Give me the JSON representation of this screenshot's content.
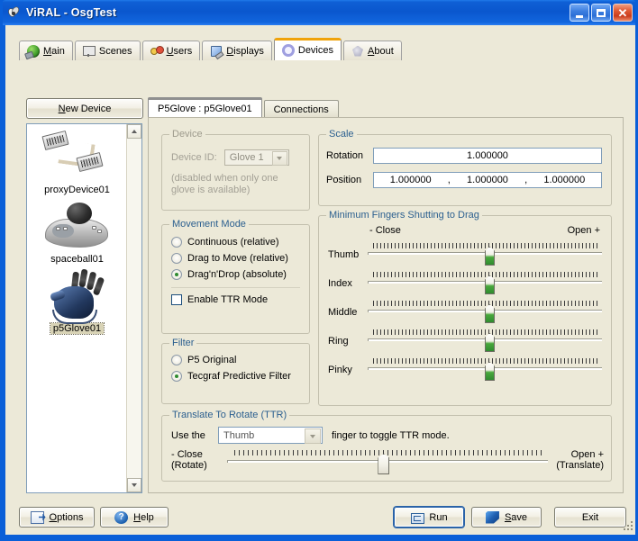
{
  "window": {
    "title": "ViRAL - OsgTest",
    "icon": "app-icon",
    "minimize": "_",
    "maximize": "□",
    "close": "✕"
  },
  "tabs": [
    {
      "label": "Main",
      "icon": "globe-icon",
      "underline": "M",
      "active": false
    },
    {
      "label": "Scenes",
      "icon": "screen-icon",
      "underline": "",
      "active": false
    },
    {
      "label": "Users",
      "icon": "users-icon",
      "underline": "U",
      "active": false
    },
    {
      "label": "Displays",
      "icon": "display-icon",
      "underline": "D",
      "active": false
    },
    {
      "label": "Devices",
      "icon": "device-icon",
      "underline": "",
      "active": true
    },
    {
      "label": "About",
      "icon": "about-icon",
      "underline": "A",
      "active": false
    }
  ],
  "left_pane": {
    "new_device_button": "New Device",
    "new_device_underline": "N",
    "devices": [
      {
        "name": "proxyDevice01",
        "thumb": "proxy-device-thumb",
        "selected": false
      },
      {
        "name": "spaceball01",
        "thumb": "spaceball-thumb",
        "selected": false
      },
      {
        "name": "p5Glove01",
        "thumb": "p5glove-thumb",
        "selected": true
      }
    ]
  },
  "inner_tabs": [
    {
      "label": "P5Glove : p5Glove01",
      "active": true
    },
    {
      "label": "Connections",
      "active": false
    }
  ],
  "device_group": {
    "title": "Device",
    "device_id_label": "Device ID:",
    "device_id_value": "Glove 1",
    "note_line1": "(disabled when only one",
    "note_line2": "glove is available)",
    "disabled": true
  },
  "scale_group": {
    "title": "Scale",
    "rotation_label": "Rotation",
    "rotation_value": "1.000000",
    "position_label": "Position",
    "position_x": "1.000000",
    "position_y": "1.000000",
    "position_z": "1.000000",
    "separator": ","
  },
  "movement_group": {
    "title": "Movement Mode",
    "options": [
      {
        "label": "Continuous (relative)",
        "selected": false
      },
      {
        "label": "Drag to Move (relative)",
        "selected": false
      },
      {
        "label": "Drag'n'Drop (absolute)",
        "selected": true
      }
    ],
    "checkbox_label": "Enable TTR Mode",
    "checkbox_checked": false
  },
  "filter_group": {
    "title": "Filter",
    "options": [
      {
        "label": "P5 Original",
        "selected": false
      },
      {
        "label": "Tecgraf Predictive Filter",
        "selected": true
      }
    ]
  },
  "fingers_group": {
    "title": "Minimum Fingers Shutting to Drag",
    "left_end_label": "- Close",
    "right_end_label": "Open +",
    "sliders": [
      {
        "name": "Thumb",
        "value": 50
      },
      {
        "name": "Index",
        "value": 50
      },
      {
        "name": "Middle",
        "value": 50
      },
      {
        "name": "Ring",
        "value": 50
      },
      {
        "name": "Pinky",
        "value": 50
      }
    ]
  },
  "ttr_group": {
    "title": "Translate To Rotate (TTR)",
    "use_the_label": "Use the",
    "finger_value": "Thumb",
    "suffix_label": "finger to toggle TTR mode.",
    "left_label_line1": "- Close",
    "left_label_line2": "(Rotate)",
    "right_label_line1": "Open +",
    "right_label_line2": "(Translate)",
    "slider_value": 47
  },
  "bottom_buttons": [
    {
      "label": "Options",
      "underline": "O",
      "icon": "options-icon",
      "focused": false
    },
    {
      "label": "Help",
      "underline": "H",
      "icon": "help-icon",
      "focused": false
    },
    {
      "label": "Run",
      "underline": "",
      "icon": "run-icon",
      "focused": true
    },
    {
      "label": "Save",
      "underline": "S",
      "icon": "save-icon",
      "focused": false
    },
    {
      "label": "Exit",
      "underline": "",
      "icon": "",
      "focused": false
    }
  ],
  "colors": {
    "titlebar_blue": "#0a57ce",
    "window_face": "#ece9d8",
    "active_tab_accent": "#f0a30a",
    "group_title_blue": "#2b5f8f",
    "slider_green": "#2f8b2f",
    "field_border": "#7f9db9"
  }
}
